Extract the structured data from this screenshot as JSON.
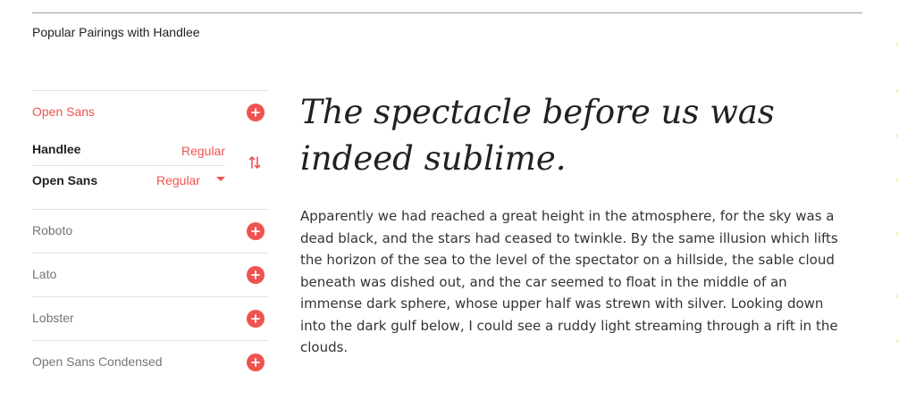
{
  "section": {
    "title": "Popular Pairings with Handlee"
  },
  "pairings": [
    {
      "name": "Open Sans",
      "active": true
    },
    {
      "name": "Roboto",
      "active": false
    },
    {
      "name": "Lato",
      "active": false
    },
    {
      "name": "Lobster",
      "active": false
    },
    {
      "name": "Open Sans Condensed",
      "active": false
    }
  ],
  "current_pair": {
    "heading_font": {
      "name": "Handlee",
      "style": "Regular"
    },
    "body_font": {
      "name": "Open Sans",
      "style": "Regular"
    }
  },
  "preview": {
    "headline": "The spectacle before us was indeed sublime.",
    "body": "Apparently we had reached a great height in the atmosphere, for the sky was a dead black, and the stars had ceased to twinkle. By the same illusion which lifts the horizon of the sea to the level of the spectator on a hillside, the sable cloud beneath was dished out, and the car seemed to float in the middle of an immense dark sphere, whose upper half was strewn with silver. Looking down into the dark gulf below, I could see a ruddy light streaming through a rift in the clouds."
  },
  "icons": {
    "add": "plus-circle-icon",
    "swap": "swap-vertical-icon",
    "dropdown": "caret-down-icon"
  },
  "colors": {
    "accent": "#ef5350",
    "text": "#212121",
    "muted": "#757575",
    "divider": "#e0e0e0"
  }
}
